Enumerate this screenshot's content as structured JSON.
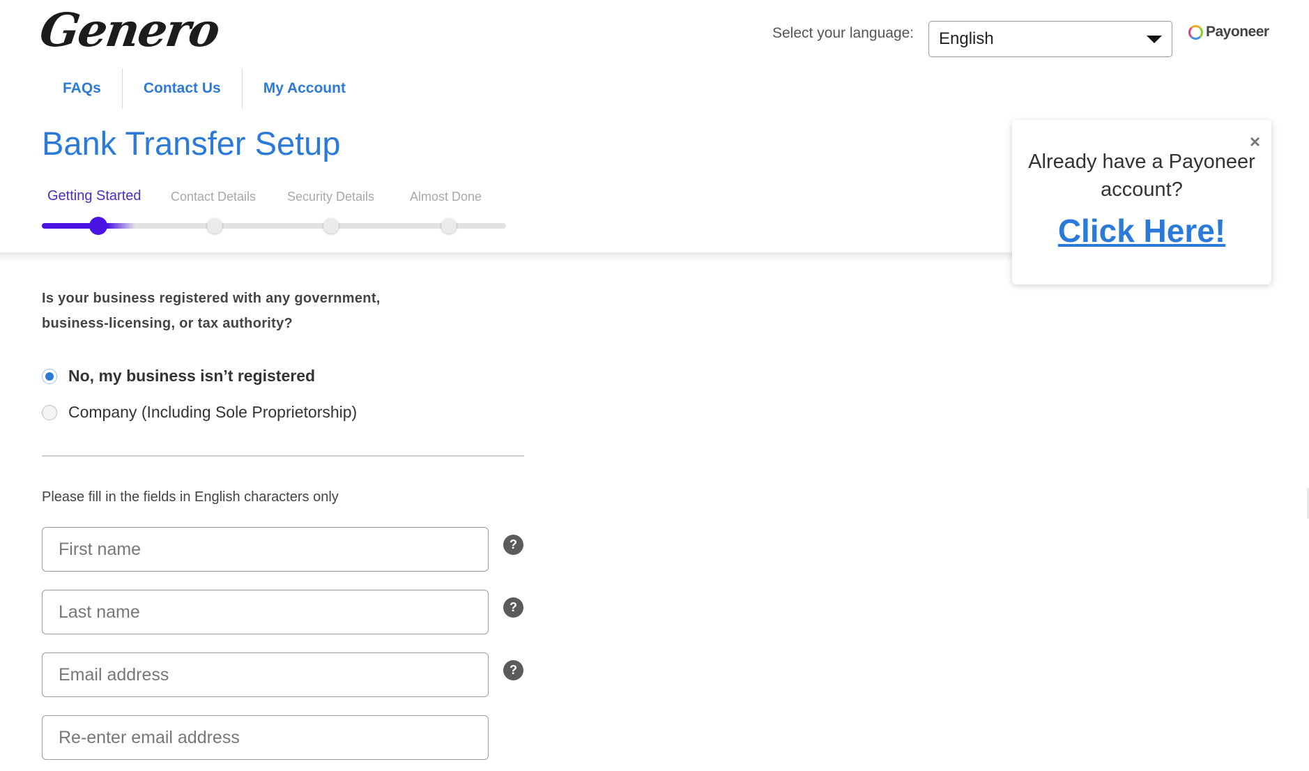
{
  "brand": {
    "logo_text": "Genero",
    "partner_logo": "Payoneer",
    "partner_ring_colors": [
      "#f5a623",
      "#7ed321",
      "#4a90e2",
      "#e0407a"
    ]
  },
  "language": {
    "label": "Select your language:",
    "selected": "English"
  },
  "nav": {
    "items": [
      {
        "label": "FAQs"
      },
      {
        "label": "Contact Us"
      },
      {
        "label": "My Account"
      }
    ]
  },
  "page": {
    "title": "Bank Transfer Setup"
  },
  "steps": {
    "current": 0,
    "progress_fraction": 0.2,
    "items": [
      {
        "label": "Getting Started"
      },
      {
        "label": "Contact Details"
      },
      {
        "label": "Security Details"
      },
      {
        "label": "Almost Done"
      }
    ]
  },
  "popup": {
    "question": "Already have a Payoneer account?",
    "link": "Click Here!",
    "close_glyph": "×"
  },
  "registration": {
    "question": "Is your business registered with any government, business-licensing, or tax authority?",
    "options": [
      {
        "label": "No, my business isn’t registered",
        "checked": true
      },
      {
        "label": "Company (Including Sole Proprietorship)",
        "checked": false
      }
    ]
  },
  "form": {
    "note": "Please fill in the fields in English characters only",
    "help_glyph": "?",
    "fields": [
      {
        "placeholder": "First name",
        "value": ""
      },
      {
        "placeholder": "Last name",
        "value": ""
      },
      {
        "placeholder": "Email address",
        "value": ""
      },
      {
        "placeholder": "Re-enter email address",
        "value": ""
      }
    ]
  },
  "colors": {
    "accent_blue": "#2b7ad9",
    "progress_purple": "#4a12e3",
    "active_step_text": "#4b2bc8"
  }
}
